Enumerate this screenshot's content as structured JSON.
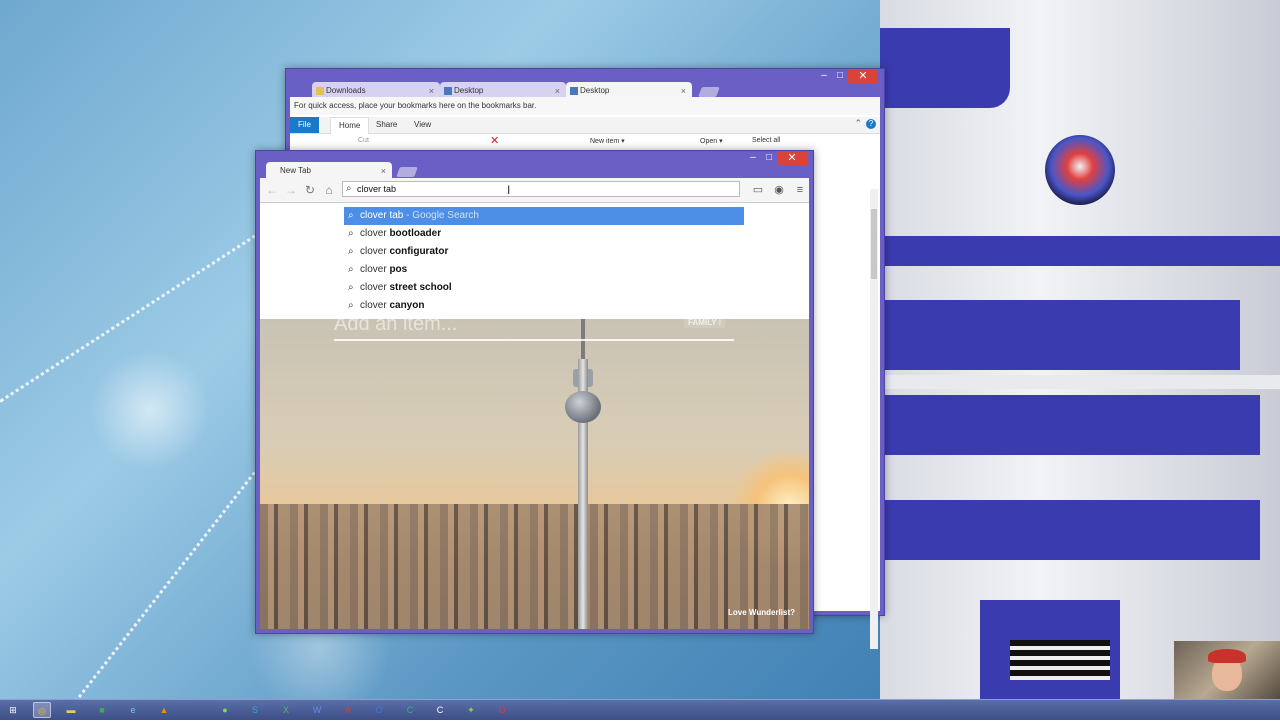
{
  "explorer_window": {
    "tabs": [
      {
        "label": "Downloads",
        "active": false
      },
      {
        "label": "Desktop",
        "active": false
      },
      {
        "label": "Desktop",
        "active": true
      }
    ],
    "bookmarks_message": "For quick access, place your bookmarks here on the bookmarks bar.",
    "ribbon_tabs": [
      "File",
      "Home",
      "Share",
      "View"
    ],
    "ribbon_items": {
      "cut": "Cut",
      "new_item": "New item ▾",
      "open": "Open ▾",
      "select_all": "Select all"
    }
  },
  "chrome_window": {
    "tab_label": "New Tab",
    "omnibox_value": "clover tab",
    "suggestions": [
      {
        "prefix": "clover tab",
        "bold": "",
        "suffix": " - Google Search",
        "selected": true
      },
      {
        "prefix": "clover ",
        "bold": "bootloader",
        "suffix": "",
        "selected": false
      },
      {
        "prefix": "clover ",
        "bold": "configurator",
        "suffix": "",
        "selected": false
      },
      {
        "prefix": "clover ",
        "bold": "pos",
        "suffix": "",
        "selected": false
      },
      {
        "prefix": "clover ",
        "bold": "street school",
        "suffix": "",
        "selected": false
      },
      {
        "prefix": "clover ",
        "bold": "canyon",
        "suffix": "",
        "selected": false
      }
    ],
    "page": {
      "add_item_placeholder": "Add an item...",
      "list_label": "FAMILY ⁝",
      "credit": "Love Wunderlist?"
    }
  },
  "taskbar": {
    "start_icon": "windows-logo-icon",
    "items": [
      "chrome",
      "explorer",
      "excel-green",
      "ie",
      "vlc",
      "spotify",
      "skype",
      "excel",
      "word",
      "acrobat",
      "outlook",
      "camtasia",
      "c-app",
      "android",
      "opera"
    ]
  }
}
